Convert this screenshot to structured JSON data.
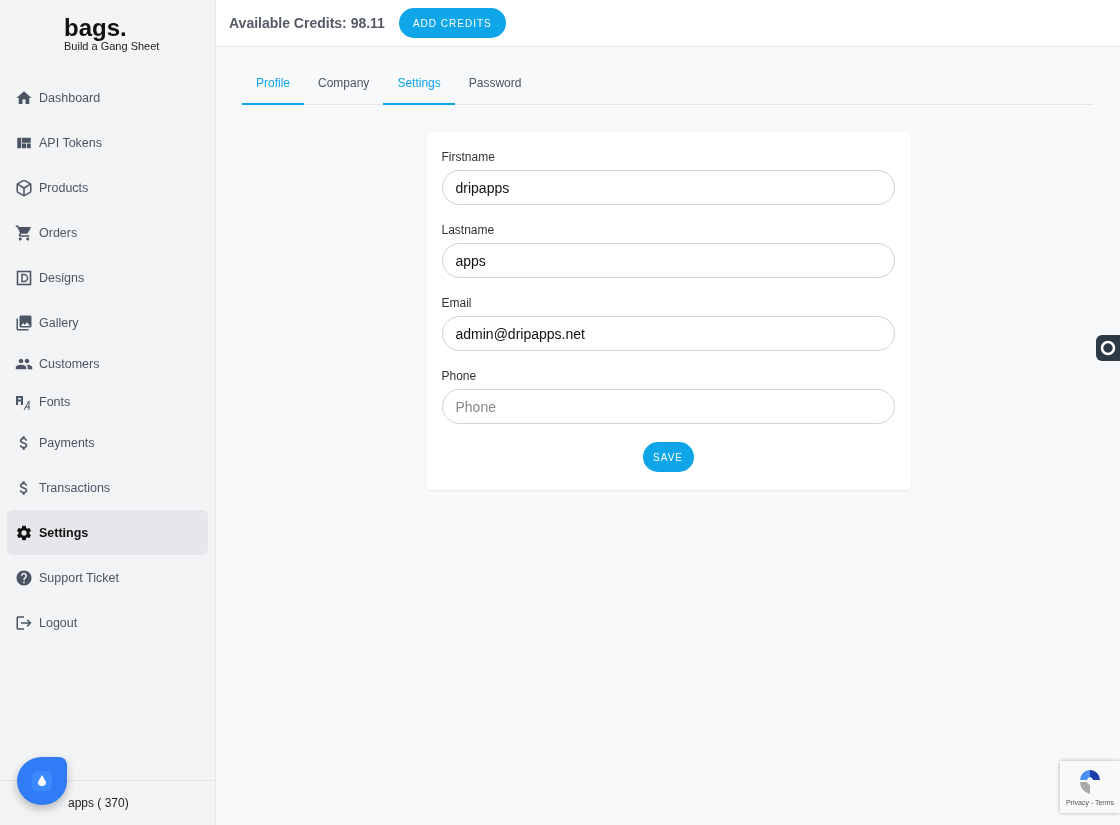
{
  "brand": {
    "name": "bags.",
    "tagline": "Build a Gang Sheet"
  },
  "sidebar": {
    "items": [
      {
        "label": "Dashboard",
        "selected": false
      },
      {
        "label": "API Tokens",
        "selected": false
      },
      {
        "label": "Products",
        "selected": false
      },
      {
        "label": "Orders",
        "selected": false
      },
      {
        "label": "Designs",
        "selected": false
      },
      {
        "label": "Gallery",
        "selected": false
      },
      {
        "label": "Customers",
        "selected": false
      },
      {
        "label": "Fonts",
        "selected": false
      },
      {
        "label": "Payments",
        "selected": false
      },
      {
        "label": "Transactions",
        "selected": false
      },
      {
        "label": "Settings",
        "selected": true
      },
      {
        "label": "Support Ticket",
        "selected": false
      },
      {
        "label": "Logout",
        "selected": false
      }
    ],
    "user": "apps ( 370)"
  },
  "header": {
    "credits": "Available Credits: 98.11",
    "button": "ADD CREDITS"
  },
  "tabs": [
    {
      "label": "Profile",
      "selected": true
    },
    {
      "label": "Company",
      "selected": false
    },
    {
      "label": "Settings",
      "selected": true
    },
    {
      "label": "Password",
      "selected": false
    }
  ],
  "form": {
    "fields": [
      {
        "label": "Firstname",
        "value": "dripapps"
      },
      {
        "label": "Lastname",
        "value": "apps"
      },
      {
        "label": "Email",
        "value": "admin@dripapps.net"
      },
      {
        "label": "Phone",
        "placeholder": "Phone"
      }
    ],
    "button": "SAVE"
  },
  "recaptcha": {
    "links": "Privacy - Terms"
  }
}
